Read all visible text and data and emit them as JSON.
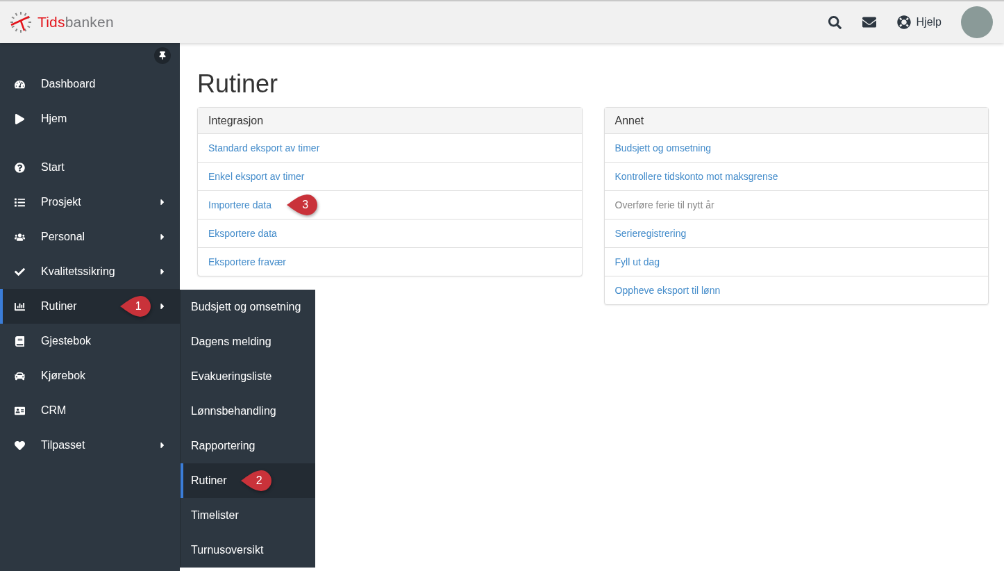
{
  "header": {
    "logo": {
      "strong": "Tids",
      "rest": "banken"
    },
    "help_label": "Hjelp"
  },
  "sidebar": {
    "groups": [
      [
        {
          "label": "Dashboard",
          "has_submenu": false,
          "selected": false
        },
        {
          "label": "Hjem",
          "has_submenu": false,
          "selected": false
        }
      ],
      [
        {
          "label": "Start",
          "has_submenu": false,
          "selected": false
        },
        {
          "label": "Prosjekt",
          "has_submenu": true,
          "selected": false
        },
        {
          "label": "Personal",
          "has_submenu": true,
          "selected": false
        },
        {
          "label": "Kvalitetssikring",
          "has_submenu": true,
          "selected": false
        },
        {
          "label": "Rutiner",
          "has_submenu": true,
          "selected": true,
          "callout": "1"
        },
        {
          "label": "Gjestebok",
          "has_submenu": false,
          "selected": false
        },
        {
          "label": "Kjørebok",
          "has_submenu": false,
          "selected": false
        },
        {
          "label": "CRM",
          "has_submenu": false,
          "selected": false
        },
        {
          "label": "Tilpasset",
          "has_submenu": true,
          "selected": false
        }
      ]
    ]
  },
  "submenu": {
    "items": [
      {
        "label": "Budsjett og omsetning",
        "selected": false
      },
      {
        "label": "Dagens melding",
        "selected": false
      },
      {
        "label": "Evakueringsliste",
        "selected": false
      },
      {
        "label": "Lønnsbehandling",
        "selected": false
      },
      {
        "label": "Rapportering",
        "selected": false
      },
      {
        "label": "Rutiner",
        "selected": true,
        "callout": "2"
      },
      {
        "label": "Timelister",
        "selected": false
      },
      {
        "label": "Turnusoversikt",
        "selected": false
      }
    ]
  },
  "page_title": "Rutiner",
  "panels": [
    {
      "title": "Integrasjon",
      "links": [
        {
          "label": "Standard eksport av timer",
          "disabled": false
        },
        {
          "label": "Enkel eksport av timer",
          "disabled": false
        },
        {
          "label": "Importere data",
          "disabled": false,
          "callout": "3"
        },
        {
          "label": "Eksportere data",
          "disabled": false
        },
        {
          "label": "Eksportere fravær",
          "disabled": false
        }
      ]
    },
    {
      "title": "Annet",
      "links": [
        {
          "label": "Budsjett og omsetning",
          "disabled": false
        },
        {
          "label": "Kontrollere tidskonto mot maksgrense",
          "disabled": false
        },
        {
          "label": "Overføre ferie til nytt år",
          "disabled": true
        },
        {
          "label": "Serieregistrering",
          "disabled": false
        },
        {
          "label": "Fyll ut dag",
          "disabled": false
        },
        {
          "label": "Oppheve eksport til lønn",
          "disabled": false
        }
      ]
    }
  ]
}
